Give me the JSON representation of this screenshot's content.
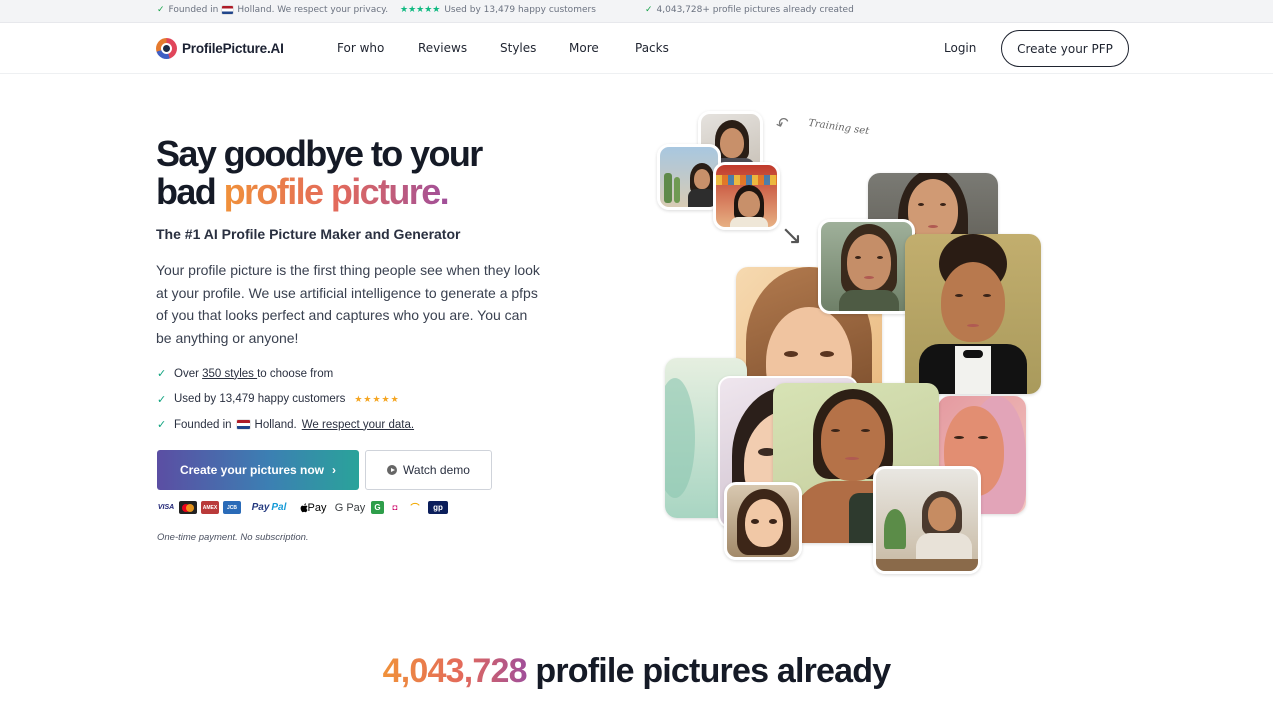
{
  "topbar": {
    "founded_prefix": "Founded in",
    "founded_suffix": "Holland. We respect your privacy.",
    "stars": "★★★★★",
    "used_by": "Used by 13,479 happy customers",
    "created": "4,043,728+ profile pictures already created"
  },
  "nav": {
    "logo": "ProfilePicture.AI",
    "links": [
      "For who",
      "Reviews",
      "Styles",
      "More",
      "Packs"
    ],
    "login": "Login",
    "cta": "Create your PFP"
  },
  "hero": {
    "headline_line1": "Say goodbye to your",
    "headline_plain": "bad ",
    "headline_accent": "profile picture.",
    "subheading": "The #1 AI Profile Picture Maker and Generator",
    "description": "Your profile picture is the first thing people see when they look at your profile. We use artificial intelligence to generate a pfps of you that looks perfect and captures who you are. You can be anything or anyone!",
    "bullets": {
      "b1_prefix": "Over ",
      "b1_link": "350 styles ",
      "b1_suffix": "to choose from",
      "b2_text": "Used by 13,479 happy customers",
      "b2_stars": "★★★★★",
      "b3_prefix": "Founded in",
      "b3_middle": "Holland.",
      "b3_link": "We respect your data."
    },
    "primary_button": "Create your pictures now",
    "primary_chevron": "›",
    "demo_button": "Watch demo",
    "note": "One-time payment. No subscription.",
    "training_label": "Training set"
  },
  "payments": {
    "visa": "VISA",
    "amex": "AMEX",
    "jcb": "JCB",
    "paypal_a": "Pay",
    "paypal_b": "Pal",
    "applepay": "Pay",
    "googlepay": "G Pay",
    "gp": "gp"
  },
  "stats": {
    "number": "4,043,728",
    "text": " profile pictures already"
  },
  "colors": {
    "accent_gradient_start": "#f0913a",
    "accent_gradient_end": "#a04f9a",
    "primary_button_start": "#5b4ea3",
    "primary_button_end": "#2aa39a",
    "check_green": "#10a37f",
    "star_orange": "#f5a623"
  }
}
